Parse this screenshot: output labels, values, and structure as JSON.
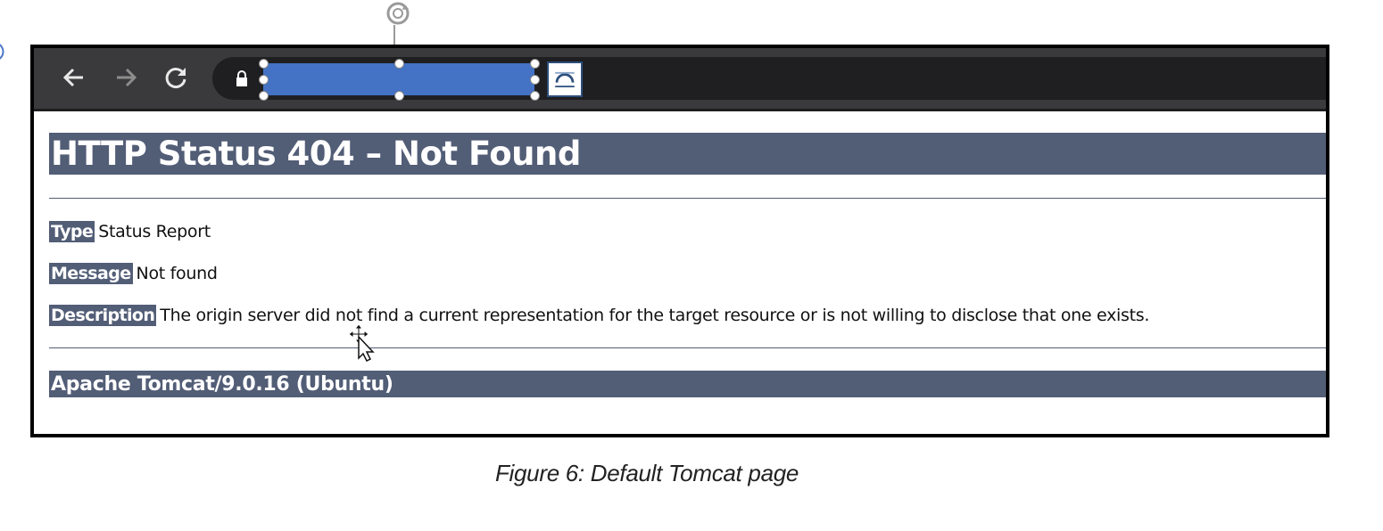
{
  "page": {
    "heading": "HTTP Status 404 – Not Found",
    "type_label": "Type",
    "type_value": "Status Report",
    "message_label": "Message",
    "message_value": "Not found",
    "description_label": "Description",
    "description_value": "The origin server did not find a current representation for the target resource or is not willing to disclose that one exists.",
    "footer": "Apache Tomcat/9.0.16 (Ubuntu)"
  },
  "caption": "Figure 6: Default Tomcat page",
  "icons": {
    "back": "arrow-left",
    "forward": "arrow-right",
    "reload": "reload",
    "lock": "lock",
    "cast": "cast-screen",
    "rotate": "rotate-handle",
    "cursor": "move-cursor"
  },
  "colors": {
    "heading_bar": "#525d76",
    "url_selection": "#4472c4",
    "toolbar": "#3a3a3c"
  }
}
